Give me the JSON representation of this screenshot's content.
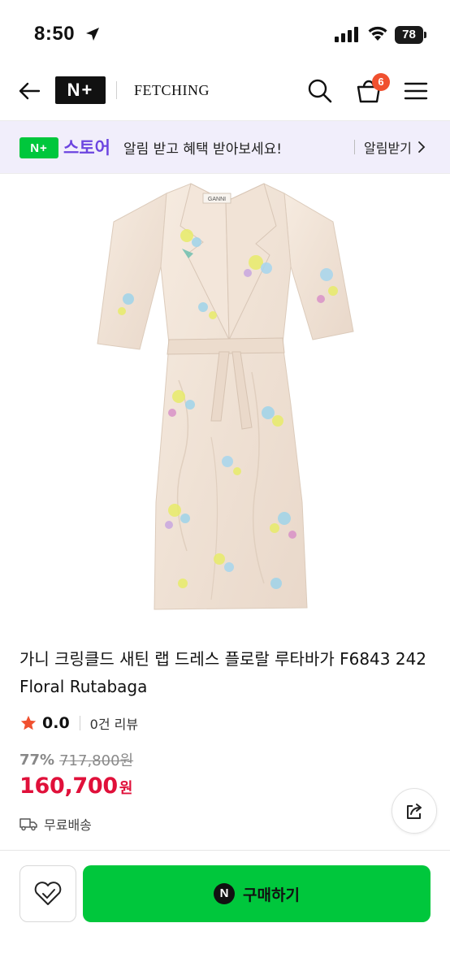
{
  "status_bar": {
    "time": "8:50",
    "battery": "78"
  },
  "header": {
    "logo_text": "N+",
    "brand_name": "FETCHING",
    "cart_count": "6",
    "icons": [
      "back-arrow-icon",
      "search-icon",
      "cart-icon",
      "menu-icon"
    ]
  },
  "store_banner": {
    "logo_text": "N+",
    "store_name": "스토어",
    "message": "알림 받고 혜택 받아보세요!",
    "cta_label": "알림받기",
    "accent_color": "#6c45e0"
  },
  "product": {
    "title": "가니 크링클드 새틴 랩 드레스 플로랄 루타바가 F6843 242 Floral Rutabaga",
    "image_alt": "GANNI",
    "rating": "0.0",
    "review_count": "0건 리뷰",
    "discount": "77%",
    "original_price": "717,800원",
    "sale_price": "160,700",
    "sale_unit": "원",
    "shipping": "무료배송"
  },
  "bottom_bar": {
    "buy_label": "구매하기",
    "npay_letter": "N",
    "buy_color": "#00c73c"
  }
}
